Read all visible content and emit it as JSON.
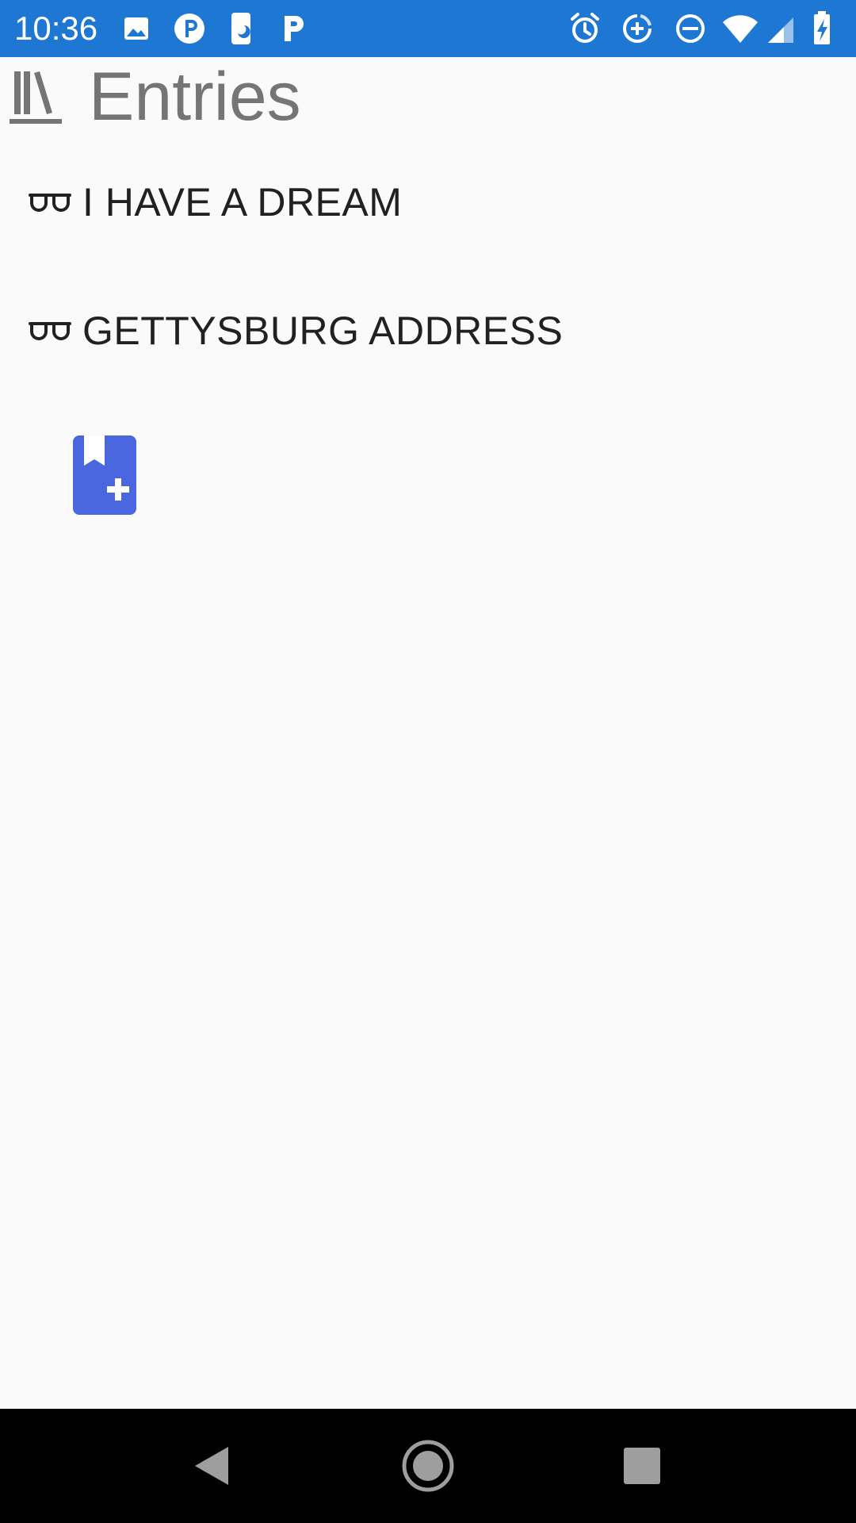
{
  "status_bar": {
    "time": "10:36",
    "background": "#1e77d2",
    "left_icons": [
      "image-notification-icon",
      "parking-app-icon",
      "night-mode-icon",
      "parking-p-icon"
    ],
    "right_icons": [
      "alarm-icon",
      "data-saver-icon",
      "do-not-disturb-icon",
      "wifi-icon",
      "cell-signal-icon",
      "battery-charging-icon"
    ]
  },
  "header": {
    "title": "Entries",
    "icon": "library-books-icon",
    "title_color": "#757575"
  },
  "entries": [
    {
      "label": "I HAVE A DREAM",
      "icon": "glasses-icon"
    },
    {
      "label": "GETTYSBURG ADDRESS",
      "icon": "glasses-icon"
    }
  ],
  "add_button": {
    "icon": "bookmark-add-icon",
    "color": "#4a67e0"
  },
  "nav_bar": {
    "buttons": [
      "back-icon",
      "home-icon",
      "recents-icon"
    ],
    "icon_color": "#9e9e9e"
  }
}
